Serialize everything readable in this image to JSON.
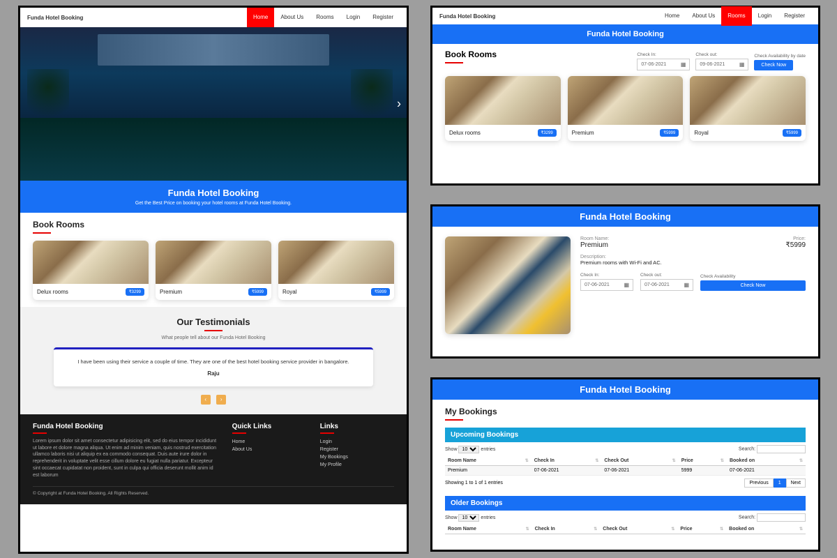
{
  "brand": "Funda Hotel Booking",
  "nav": {
    "items": [
      "Home",
      "About Us",
      "Rooms",
      "Login",
      "Register"
    ]
  },
  "p1": {
    "activeNav": "Home",
    "hero_tag": "Get the Best Price on booking your hotel rooms at Funda Hotel Booking.",
    "book_title": "Book Rooms",
    "rooms": [
      {
        "n": "Delux rooms",
        "p": "₹3299"
      },
      {
        "n": "Premium",
        "p": "₹5999"
      },
      {
        "n": "Royal",
        "p": "₹5999"
      }
    ],
    "testi": {
      "title": "Our Testimonials",
      "sub": "What people tell about our Funda Hotel Booking",
      "text": "I have been using their service a couple of time. They are one of the best hotel booking service provider in bangalore.",
      "author": "Raju"
    },
    "footer": {
      "about": "Lorem ipsum dolor sit amet consectetur adipisicing elit, sed do eius tempor incididunt ut labore et dolore magna aliqua. Ut enim ad minim veniam, quis nostrud exercitation ullamco laboris nisi ut aliquip ex ea commodo consequat. Duis aute irure dolor in reprehenderit in voluptate velit esse cillum dolore eu fugiat nulla pariatur. Excepteur sint occaecat cupidatat non proident, sunt in culpa qui officia deserunt mollit anim id est laborum",
      "quick": {
        "title": "Quick Links",
        "links": [
          "Home",
          "About Us"
        ]
      },
      "links": {
        "title": "Links",
        "links": [
          "Login",
          "Register",
          "My Bookings",
          "My Profile"
        ]
      },
      "copy": "© Copyright at Funda Hotel Booking. All Rights Reserved."
    }
  },
  "p2": {
    "activeNav": "Rooms",
    "title": "Book Rooms",
    "checkin": {
      "l": "Check In:",
      "v": "07-06-2021"
    },
    "checkout": {
      "l": "Check out:",
      "v": "09-06-2021"
    },
    "avail": {
      "l": "Check Availability by date",
      "btn": "Check Now"
    },
    "rooms": [
      {
        "n": "Delux rooms",
        "p": "₹3299"
      },
      {
        "n": "Premium",
        "p": "₹5999"
      },
      {
        "n": "Royal",
        "p": "₹5999"
      }
    ]
  },
  "p3": {
    "name_l": "Room Name:",
    "name": "Premium",
    "price_l": "Price:",
    "price": "₹5999",
    "desc_l": "Description:",
    "desc": "Premium rooms with Wi-Fi and AC.",
    "checkin": {
      "l": "Check In:",
      "v": "07-06-2021"
    },
    "checkout": {
      "l": "Check out:",
      "v": "07-06-2021"
    },
    "avail": {
      "l": "Check Availability",
      "btn": "Check Now"
    }
  },
  "p4": {
    "title": "My Bookings",
    "upcoming": "Upcoming Bookings",
    "older": "Older Bookings",
    "show": "Show",
    "entries": "entries",
    "entries_n": "10",
    "search": "Search:",
    "cols": [
      "Room Name",
      "Check In",
      "Check Out",
      "Price",
      "Booked on"
    ],
    "row": {
      "n": "Premium",
      "ci": "07-06-2021",
      "co": "07-06-2021",
      "p": "5999",
      "b": "07-06-2021"
    },
    "info": "Showing 1 to 1 of 1 entries",
    "prev": "Previous",
    "page": "1",
    "next": "Next"
  }
}
